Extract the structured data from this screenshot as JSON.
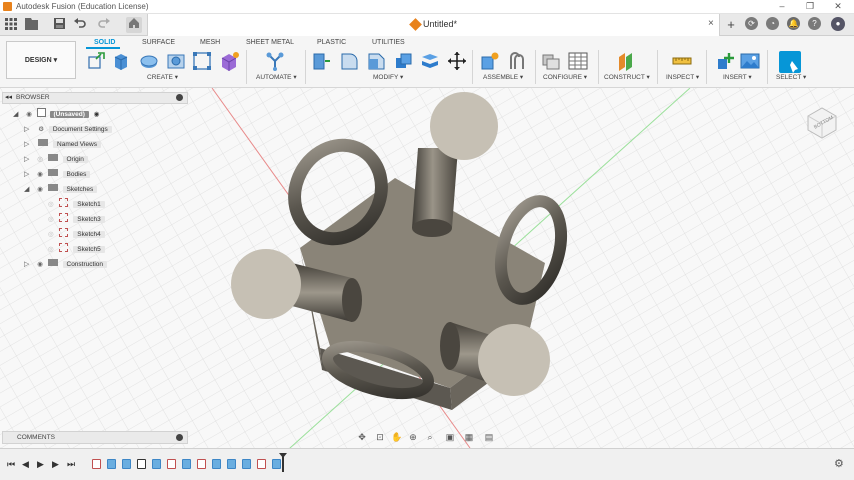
{
  "window": {
    "title": "Autodesk Fusion (Education License)",
    "controls": [
      "–",
      "❐",
      "✕"
    ]
  },
  "tabbar": {
    "document_title": "Untitled*",
    "close_glyph": "×",
    "new_tab_glyph": "+"
  },
  "workspace": {
    "design_label": "DESIGN ▾",
    "tabs": [
      "SOLID",
      "SURFACE",
      "MESH",
      "SHEET METAL",
      "PLASTIC",
      "UTILITIES"
    ],
    "active_tab": "SOLID"
  },
  "toolbar": {
    "groups": [
      "CREATE ▾",
      "AUTOMATE ▾",
      "MODIFY ▾",
      "ASSEMBLE ▾",
      "CONFIGURE ▾",
      "CONSTRUCT ▾",
      "INSPECT ▾",
      "INSERT ▾",
      "SELECT ▾"
    ]
  },
  "browser": {
    "title": "BROWSER",
    "items": [
      {
        "label": "(Unsaved)",
        "level": 0
      },
      {
        "label": "Document Settings",
        "level": 1
      },
      {
        "label": "Named Views",
        "level": 1
      },
      {
        "label": "Origin",
        "level": 1
      },
      {
        "label": "Bodies",
        "level": 1
      },
      {
        "label": "Sketches",
        "level": 1
      },
      {
        "label": "Sketch1",
        "level": 2
      },
      {
        "label": "Sketch3",
        "level": 2
      },
      {
        "label": "Sketch4",
        "level": 2
      },
      {
        "label": "Sketch5",
        "level": 2
      },
      {
        "label": "Construction",
        "level": 1
      }
    ]
  },
  "comments": {
    "label": "COMMENTS"
  },
  "viewcube": {
    "face_label": "BOTTOM"
  },
  "colors": {
    "accent": "#0696d7",
    "body": "#8a8478",
    "brand": "#e8821c"
  },
  "icons": {
    "titlebar": "fusion-logo-icon",
    "tabs": [
      "apps-grid-icon",
      "file-icon",
      "save-icon",
      "undo-icon",
      "redo-icon",
      "home-icon"
    ],
    "right": [
      "plus-icon",
      "job-status-icon",
      "notifications-icon",
      "help-icon",
      "user-avatar-icon"
    ],
    "timeline": [
      "first-icon",
      "previous-icon",
      "play-icon",
      "next-icon",
      "last-icon",
      "settings-gear-icon"
    ]
  }
}
